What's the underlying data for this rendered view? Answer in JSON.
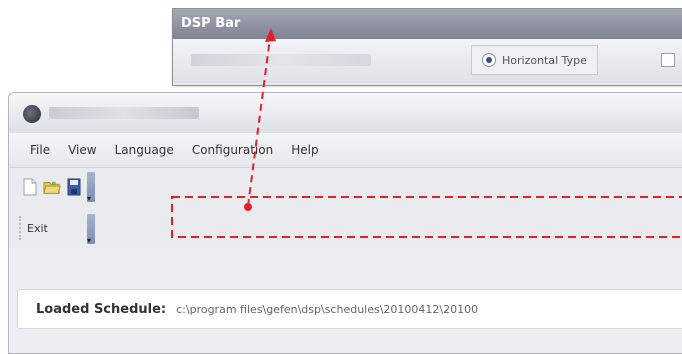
{
  "dsp_bar": {
    "title": "DSP Bar",
    "radio_label": "Horizontal Type"
  },
  "window": {
    "menu": [
      "File",
      "View",
      "Language",
      "Configuration",
      "Help"
    ],
    "toolbar_icons": [
      "new-file-icon",
      "open-folder-icon",
      "save-icon"
    ],
    "exit_label": "Exit",
    "status": {
      "label": "Loaded Schedule:",
      "value": "c:\\program files\\gefen\\dsp\\schedules\\20100412\\20100"
    }
  },
  "callout": {
    "color": "#e0212b"
  }
}
